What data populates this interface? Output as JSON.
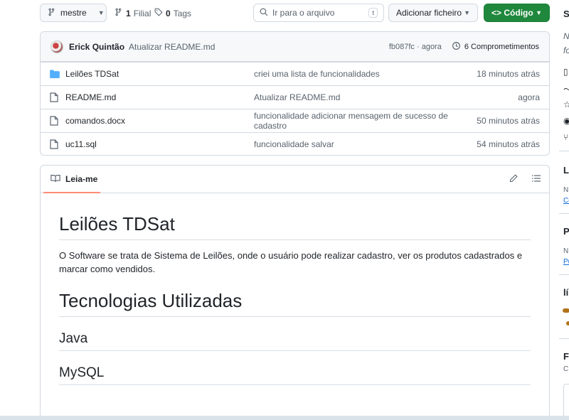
{
  "toolbar": {
    "branch": "mestre",
    "branches_count": "1",
    "branches_label": "Filial",
    "tags_count": "0",
    "tags_label": "Tags",
    "search_placeholder": "Ir para o arquivo",
    "search_shortcut": "t",
    "add_file_label": "Adicionar ficheiro",
    "code_label": "Código"
  },
  "commit": {
    "author": "Erick Quintão",
    "message": "Atualizar README.md",
    "hash": "fb087fc",
    "separator": "·",
    "age": "agora",
    "commits_count_label": "6 Comprometimentos"
  },
  "files": [
    {
      "name": "Leilões TDSat",
      "type": "folder",
      "message": "criei uma lista de funcionalidades",
      "age": "18 minutos atrás"
    },
    {
      "name": "README.md",
      "type": "file",
      "message": "Atualizar README.md",
      "age": "agora"
    },
    {
      "name": "comandos.docx",
      "type": "file",
      "message": "funcionalidade adicionar mensagem de sucesso de cadastro",
      "age": "50 minutos atrás"
    },
    {
      "name": "uc11.sql",
      "type": "file",
      "message": "funcionalidade salvar",
      "age": "54 minutos atrás"
    }
  ],
  "readme": {
    "tab_label": "Leia-me",
    "title": "Leilões TDSat",
    "description": "O Software se trata de Sistema de Leilões, onde o usuário pode realizar cadastro, ver os produtos cadastrados e marcar como vendidos.",
    "tech_heading": "Tecnologias Utilizadas",
    "tech_items": [
      "Java",
      "MySQL"
    ]
  },
  "sidebar_fragments": {
    "s": "S",
    "n": "N",
    "fo": "fo",
    "la": "La",
    "n2": "N",
    "co": "Co",
    "p": "P",
    "n3": "N",
    "pu": "Pu",
    "li": "lí",
    "fl": "Fl",
    "c": "C"
  },
  "colors": {
    "accent_green": "#1f883d",
    "link_blue": "#0969da",
    "folder_blue": "#54aeff",
    "tab_underline": "#fd8c73"
  }
}
